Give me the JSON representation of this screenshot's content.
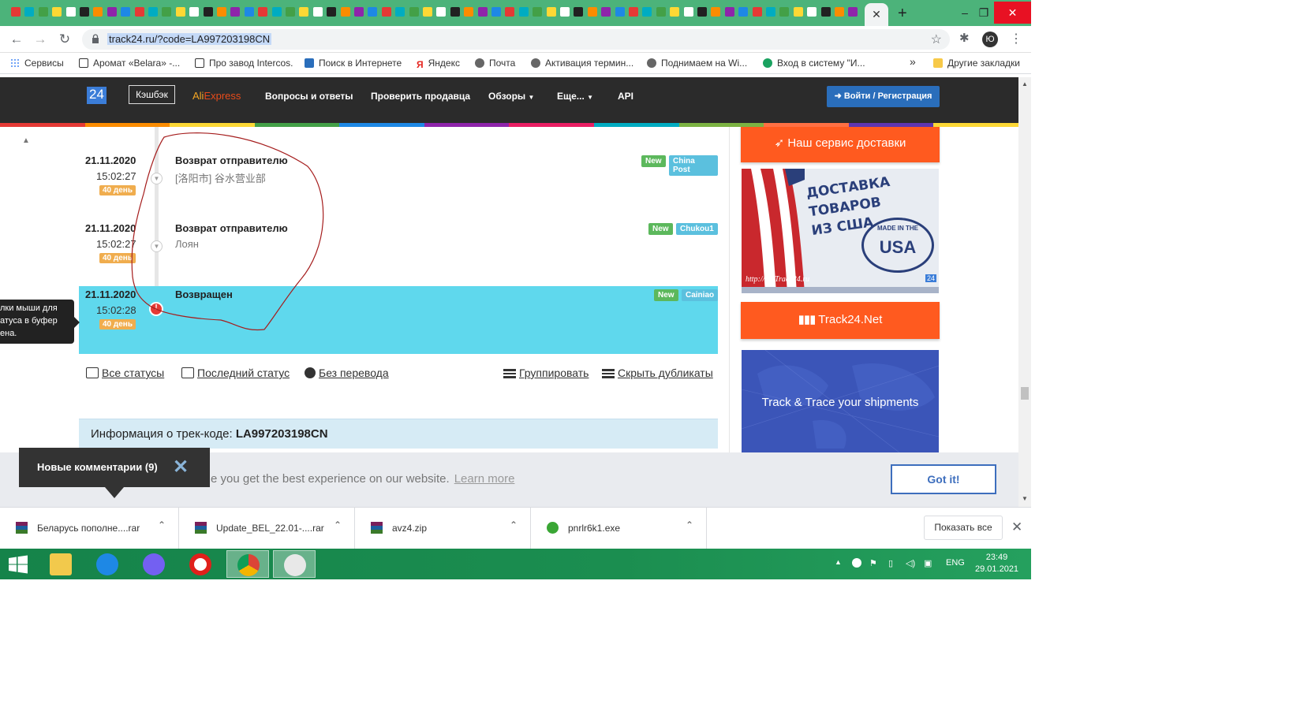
{
  "browser": {
    "url": "track24.ru/?code=LA997203198CN",
    "profile_initial": "Ю",
    "bookmarks": [
      {
        "label": "Сервисы"
      },
      {
        "label": "Аромат «Belara» -..."
      },
      {
        "label": "Про завод Intercos."
      },
      {
        "label": "Поиск в Интернете"
      },
      {
        "label": "Яндекс"
      },
      {
        "label": "Почта"
      },
      {
        "label": "Активация термин..."
      },
      {
        "label": "Поднимаем на Wi..."
      },
      {
        "label": "Вход в систему \"И..."
      }
    ],
    "bookmarks_more": "»",
    "other_bookmarks": "Другие закладки"
  },
  "site": {
    "logo": "24",
    "nav": {
      "cashback": "Кэшбэк",
      "ali_prefix": "Ali",
      "ali_suffix": "Express",
      "faq": "Вопросы и ответы",
      "check_seller": "Проверить продавца",
      "reviews": "Обзоры",
      "more": "Еще...",
      "api": "API"
    },
    "login": "Войти / Регистрация"
  },
  "events": [
    {
      "date": "21.11.2020",
      "time": "15:02:27",
      "days": "40 день",
      "title": "Возврат отправителю",
      "sub": "[洛阳市] 谷水营业部",
      "badge_new": "New",
      "carrier": "China Post",
      "current": false
    },
    {
      "date": "21.11.2020",
      "time": "15:02:27",
      "days": "40 день",
      "title": "Возврат отправителю",
      "sub": "Лоян",
      "badge_new": "New",
      "carrier": "Chukou1",
      "current": false
    },
    {
      "date": "21.11.2020",
      "time": "15:02:28",
      "days": "40 день",
      "title": "Возвращен",
      "sub": "",
      "badge_new": "New",
      "carrier": "Cainiao",
      "current": true
    }
  ],
  "tooltip": {
    "line1": "лки мыши для",
    "line2": "атуса в буфер",
    "line3": "ена."
  },
  "actions": {
    "all_statuses": "Все статусы",
    "last_status": "Последний статус",
    "no_translation": "Без перевода",
    "group": "Группировать",
    "hide_duplicates": "Скрыть дубликаты"
  },
  "info": {
    "label": "Информация о трек-коде:",
    "code": "LA997203198CN"
  },
  "sidebar": {
    "delivery_service": "Наш сервис доставки",
    "usa_banner_line1": "ДОСТАВКА",
    "usa_banner_line2": "ТОВАРОВ",
    "usa_banner_line3": "ИЗ США",
    "usa_seal": "USA",
    "usa_seal_ring": "MADE IN THE",
    "usa_banner_url": "http://mf.Track24.ru",
    "usa_banner_badge": "24",
    "track24_net": "Track24.Net",
    "world_banner": "Track & Trace your shipments"
  },
  "cookie": {
    "text": "e you get the best experience on our website.",
    "learn_more": "Learn more",
    "got_it": "Got it!"
  },
  "comments_popup": {
    "text": "Новые комментарии (9)",
    "close": "✕"
  },
  "downloads": [
    {
      "name": "Беларусь пополне....rar"
    },
    {
      "name": "Update_BEL_22.01-....rar"
    },
    {
      "name": "avz4.zip"
    },
    {
      "name": "pnrlr6k1.exe"
    }
  ],
  "downloads_show_all": "Показать все",
  "taskbar": {
    "language": "ENG",
    "time": "23:49",
    "date": "29.01.2021"
  },
  "colors": {
    "tabstrip": "#4cb37a",
    "header": "#2b2b2b",
    "accent_orange": "#ff5a1f",
    "current_event": "#5fd8ed",
    "login_blue": "#2a6ebb"
  }
}
